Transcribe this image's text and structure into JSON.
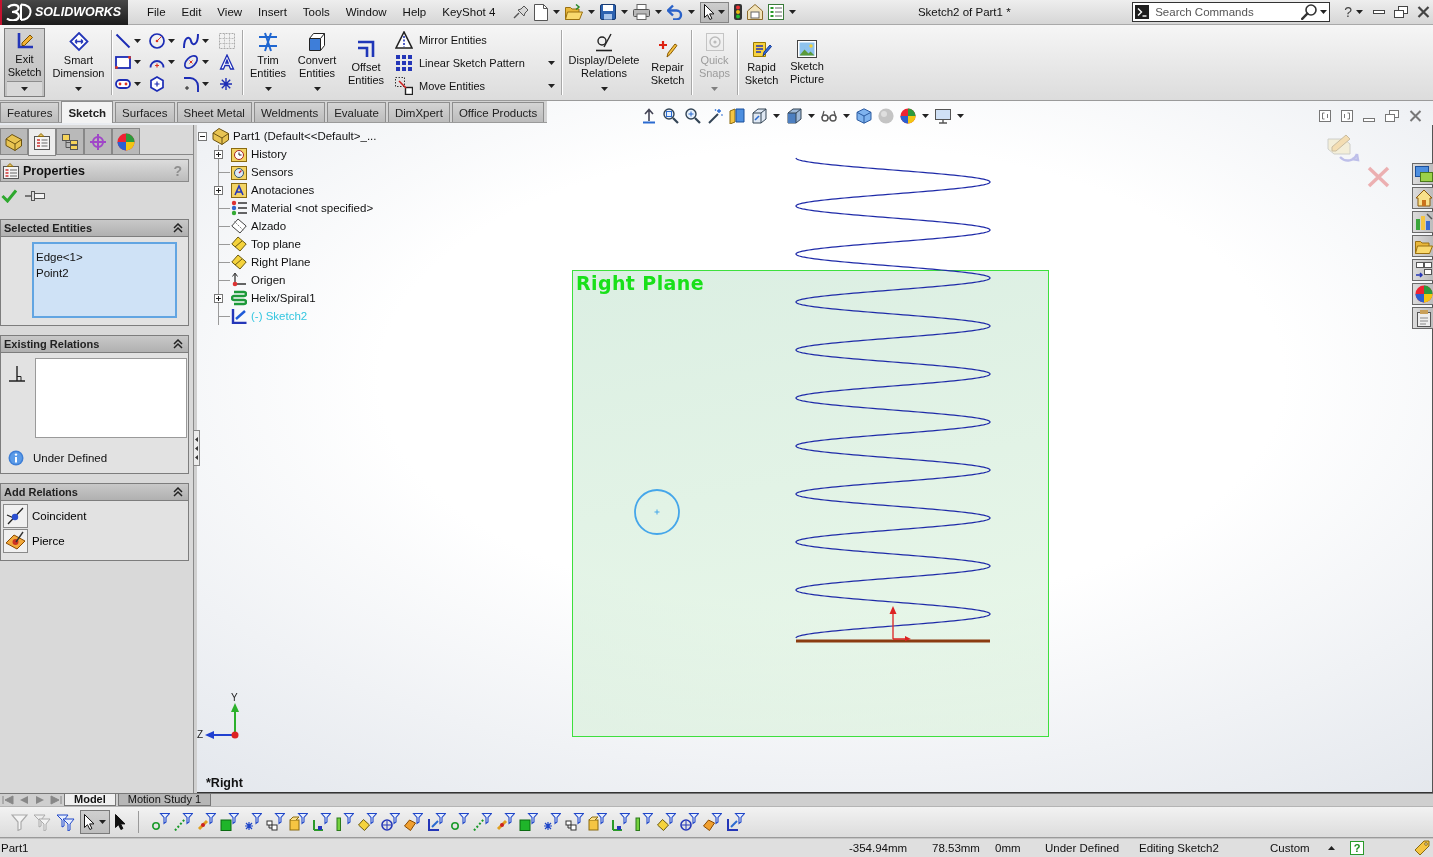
{
  "app": {
    "brand": "SOLIDWORKS"
  },
  "menu": [
    "File",
    "Edit",
    "View",
    "Insert",
    "Tools",
    "Window",
    "Help",
    "KeyShot 4"
  ],
  "quick_access": {
    "select_active": true
  },
  "window": {
    "title": "Sketch2 of Part1 *"
  },
  "search": {
    "placeholder": "Search Commands"
  },
  "help_menu": "?",
  "ribbon": {
    "groups": [
      {
        "items": [
          {
            "kind": "large",
            "label": "Exit Sketch",
            "active": true,
            "disabled": false,
            "dropdown": true
          },
          {
            "kind": "large",
            "label": "Smart Dimension",
            "active": false,
            "disabled": false,
            "dropdown": true
          }
        ]
      },
      {
        "items": [
          {
            "kind": "tool_grid"
          }
        ]
      },
      {
        "items": [
          {
            "kind": "large",
            "label": "Trim Entities",
            "active": false,
            "disabled": false,
            "dropdown": true
          },
          {
            "kind": "large",
            "label": "Convert Entities",
            "active": false,
            "disabled": false,
            "dropdown": true
          },
          {
            "kind": "large",
            "label": "Offset Entities",
            "active": false,
            "disabled": false,
            "dropdown": false
          },
          {
            "kind": "stack",
            "items": [
              {
                "label": "Mirror Entities",
                "dropdown": false
              },
              {
                "label": "Linear Sketch Pattern",
                "dropdown": true
              },
              {
                "label": "Move Entities",
                "dropdown": true
              }
            ]
          }
        ]
      },
      {
        "items": [
          {
            "kind": "large",
            "label": "Display/Delete Relations",
            "active": false,
            "disabled": false,
            "dropdown": true
          },
          {
            "kind": "large",
            "label": "Repair Sketch",
            "active": false,
            "disabled": false,
            "dropdown": false
          }
        ]
      },
      {
        "items": [
          {
            "kind": "large",
            "label": "Quick Snaps",
            "active": false,
            "disabled": true,
            "dropdown": true
          }
        ]
      },
      {
        "items": [
          {
            "kind": "large",
            "label": "Rapid Sketch",
            "active": false,
            "disabled": false,
            "dropdown": false
          },
          {
            "kind": "large",
            "label": "Sketch Picture",
            "active": false,
            "disabled": false,
            "dropdown": false
          }
        ]
      }
    ]
  },
  "command_tabs": [
    {
      "label": "Features",
      "selected": false
    },
    {
      "label": "Sketch",
      "selected": true
    },
    {
      "label": "Surfaces",
      "selected": false
    },
    {
      "label": "Sheet Metal",
      "selected": false
    },
    {
      "label": "Weldments",
      "selected": false
    },
    {
      "label": "Evaluate",
      "selected": false
    },
    {
      "label": "DimXpert",
      "selected": false
    },
    {
      "label": "Office Products",
      "selected": false
    }
  ],
  "manager_tabs": [
    {
      "selected": false
    },
    {
      "selected": true
    },
    {
      "selected": false
    },
    {
      "selected": false
    },
    {
      "selected": false
    }
  ],
  "property_manager": {
    "title": "Properties",
    "help": "?",
    "sections": [
      {
        "kind": "selected_entities",
        "title": "Selected Entities",
        "expanded": true,
        "items": [
          "Edge<1>",
          "Point2"
        ]
      },
      {
        "kind": "existing_relations",
        "title": "Existing Relations",
        "expanded": true,
        "status": "Under Defined"
      },
      {
        "kind": "add_relations",
        "title": "Add Relations",
        "expanded": true,
        "items": [
          "Coincident",
          "Pierce"
        ]
      }
    ]
  },
  "feature_tree": {
    "kind": "part",
    "label": "Part1 (Default<<Default>_...",
    "expanded": true,
    "active": false,
    "children": [
      {
        "kind": "history",
        "label": "History",
        "expanded": false,
        "active": false
      },
      {
        "kind": "sensors",
        "label": "Sensors",
        "active": false
      },
      {
        "kind": "annotations",
        "label": "Anotaciones",
        "expanded": false,
        "active": false
      },
      {
        "kind": "material",
        "label": "Material <not specified>",
        "active": false
      },
      {
        "kind": "plane",
        "label": "Alzado",
        "active": false,
        "shown": false
      },
      {
        "kind": "plane",
        "label": "Top plane",
        "active": false,
        "shown": true
      },
      {
        "kind": "plane",
        "label": "Right Plane",
        "active": false,
        "shown": true
      },
      {
        "kind": "origin",
        "label": "Origen",
        "active": false
      },
      {
        "kind": "helix",
        "label": "Helix/Spiral1",
        "expanded": false,
        "active": false
      },
      {
        "kind": "sketch",
        "label": "(-) Sketch2",
        "active": true
      }
    ]
  },
  "viewport": {
    "plane_label": "Right Plane",
    "view_label": "*Right",
    "triad_labels": [
      "Y",
      "Z"
    ]
  },
  "model_tabs": [
    {
      "label": "Model",
      "selected": true
    },
    {
      "label": "Motion Study 1",
      "selected": false
    }
  ],
  "selection_filter": {
    "select_active": true
  },
  "status_bar": {
    "document": "Part1",
    "fields": [
      "-354.94mm",
      "78.53mm",
      "0mm",
      "Under Defined",
      "Editing Sketch2",
      "Custom"
    ],
    "help": "?"
  }
}
